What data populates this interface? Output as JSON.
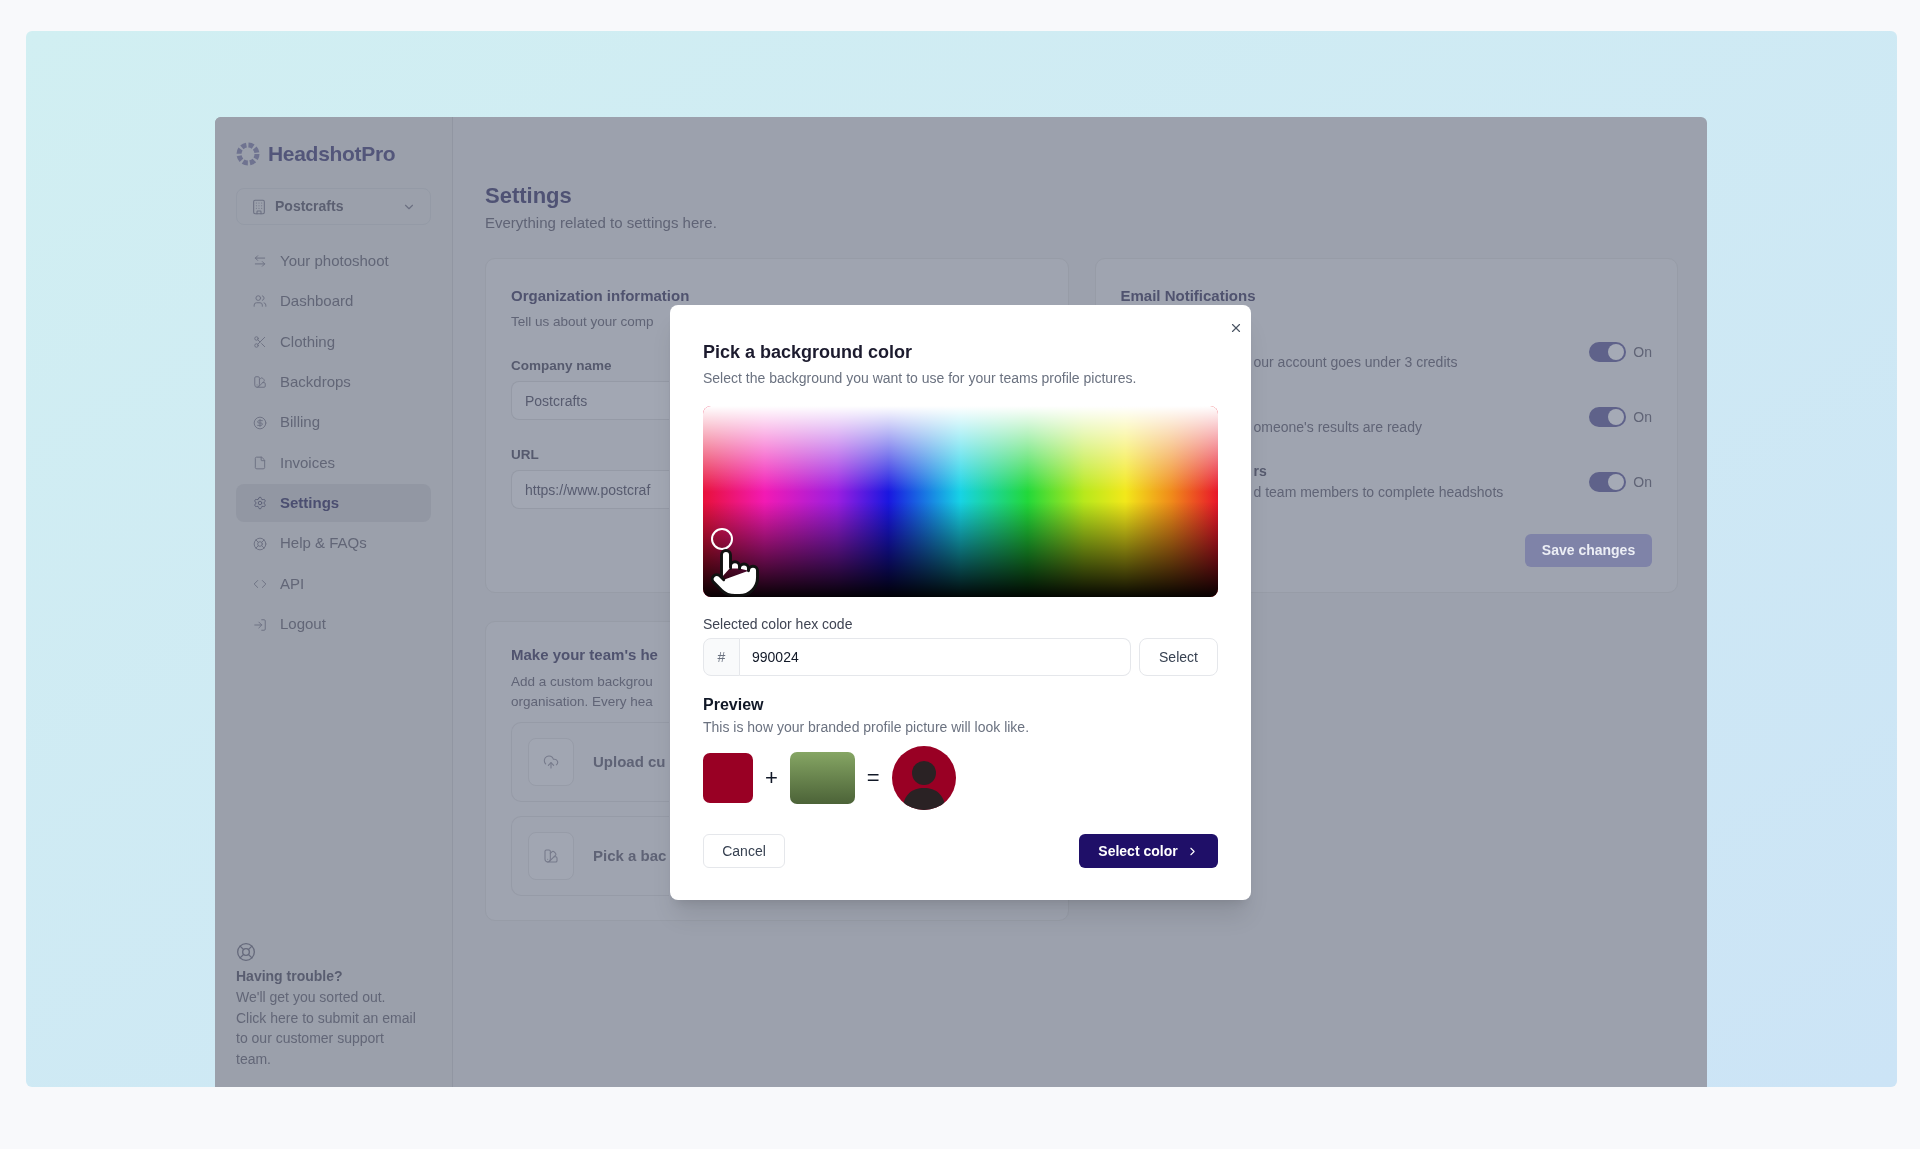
{
  "sidebar": {
    "logo": "HeadshotPro",
    "organization": "Postcrafts",
    "items": [
      {
        "label": "Your photoshoot",
        "selected": false
      },
      {
        "label": "Dashboard",
        "selected": false
      },
      {
        "label": "Clothing",
        "selected": false
      },
      {
        "label": "Backdrops",
        "selected": false
      },
      {
        "label": "Billing",
        "selected": false
      },
      {
        "label": "Invoices",
        "selected": false
      },
      {
        "label": "Settings",
        "selected": true
      },
      {
        "label": "Help & FAQs",
        "selected": false
      },
      {
        "label": "API",
        "selected": false
      },
      {
        "label": "Logout",
        "selected": false
      }
    ],
    "help": {
      "title": "Having trouble?",
      "text": "We'll get you sorted out. Click here to submit an email to our customer support team."
    }
  },
  "header": {
    "title": "Settings",
    "subtitle": "Everything related to settings here."
  },
  "organization_card": {
    "title": "Organization information",
    "subtitle": "Tell us about your comp",
    "fields": [
      {
        "label": "Company name",
        "value": "Postcrafts"
      },
      {
        "label": "URL",
        "value": "https://www.postcraf"
      }
    ]
  },
  "notifications_card": {
    "title": "Email Notifications",
    "items": [
      {
        "description": "our account goes under 3 credits",
        "on": true,
        "state_label": "On"
      },
      {
        "description": "omeone's results are ready",
        "on": true,
        "state_label": "On"
      },
      {
        "title": "rs",
        "description": "d team members to complete headshots",
        "on": true,
        "state_label": "On"
      }
    ],
    "save_button": {
      "label": "Save changes",
      "disabled": true
    }
  },
  "branding_card": {
    "title": "Make your team's he",
    "description_lines": [
      "Add a custom backgrou",
      "organisation. Every hea"
    ],
    "options": [
      {
        "label": "Upload cu"
      },
      {
        "label": "Pick a bac"
      }
    ]
  },
  "dialog": {
    "title": "Pick a background color",
    "subtitle": "Select the background you want to use for your teams profile pictures.",
    "hex_label": "Selected color hex code",
    "hex_prefix": "#",
    "hex_value": "990024",
    "select_button": "Select",
    "preview_title": "Preview",
    "preview_subtitle": "This is how your branded profile picture will look like.",
    "plus": "+",
    "equals": "=",
    "cancel_button": "Cancel",
    "confirm_button": "Select color"
  }
}
